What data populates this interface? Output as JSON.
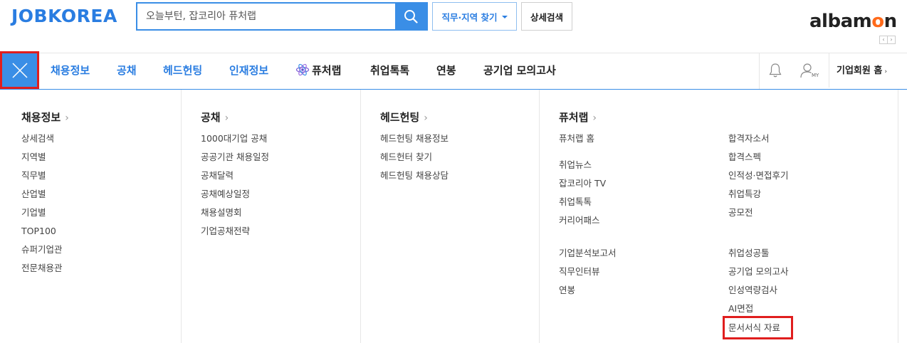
{
  "header": {
    "logo": "JOBKOREA",
    "search_placeholder": "오늘부턴, 잡코리아 퓨처랩",
    "job_region_btn": "직무·지역 찾기",
    "detail_search_btn": "상세검색",
    "albamon_logo_a": "albam",
    "albamon_logo_o": "o",
    "albamon_logo_n": "n",
    "prev_arrow": "‹",
    "next_arrow": "›"
  },
  "nav": {
    "items": [
      "채용정보",
      "공채",
      "헤드헌팅",
      "인재정보",
      "퓨처랩",
      "취업톡톡",
      "연봉",
      "공기업 모의고사"
    ],
    "my_label": "MY",
    "corp_home": "기업회원 홈",
    "corp_home_arrow": "›"
  },
  "mega_menu": {
    "chevron": "›",
    "col1": {
      "title": "채용정보",
      "links": [
        "상세검색",
        "지역별",
        "직무별",
        "산업별",
        "기업별",
        "TOP100",
        "슈퍼기업관",
        "전문채용관"
      ]
    },
    "col2": {
      "title": "공채",
      "links": [
        "1000대기업 공채",
        "공공기관 채용일정",
        "공채달력",
        "공채예상일정",
        "채용설명회",
        "기업공채전략"
      ]
    },
    "col3": {
      "title": "헤드헌팅",
      "links": [
        "헤드헌팅 채용정보",
        "헤드헌터 찾기",
        "헤드헌팅 채용상담"
      ]
    },
    "col4": {
      "title": "퓨처랩",
      "left_links": [
        "퓨처랩 홈",
        "취업뉴스",
        "잡코리아 TV",
        "취업톡톡",
        "커리어패스",
        "기업분석보고서",
        "직무인터뷰",
        "연봉"
      ],
      "right_links": [
        "합격자소서",
        "합격스펙",
        "인적성·면접후기",
        "취업특강",
        "공모전",
        "취업성공툴",
        "공기업 모의고사",
        "인성역량검사",
        "AI면접",
        "문서서식 자료"
      ]
    }
  },
  "colors": {
    "brand_blue": "#2a7de1",
    "accent_blue": "#3a8ee6",
    "highlight_red": "#e01e1e",
    "albamon_orange": "#ff6a1a"
  }
}
